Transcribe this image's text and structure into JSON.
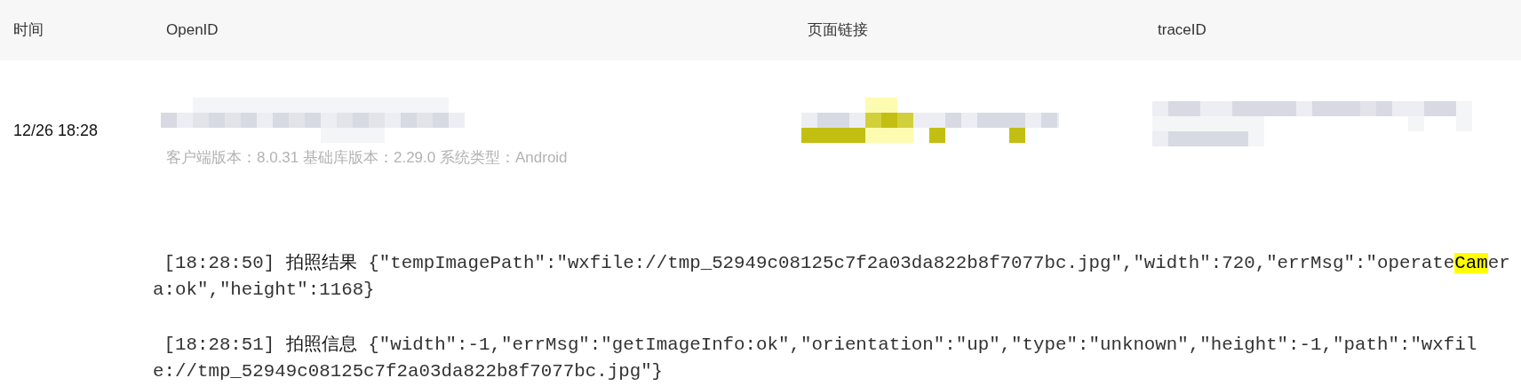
{
  "table": {
    "columns": [
      "时间",
      "OpenID",
      "页面链接",
      "traceID"
    ],
    "rows": [
      {
        "time": "12/26 18:28",
        "client_info": "客户端版本：8.0.31 基础库版本：2.29.0 系统类型：Android",
        "logs": [
          {
            "time": "[18:28:50]",
            "title": "拍照结果",
            "body": [
              {
                "kind": "text",
                "text": "{\"tempImagePath\":\"wxfile://tmp_52949c08125c7f2a03da822b8f7077bc.jpg\",\"width\":720,\"errMsg\":\"operate"
              },
              {
                "kind": "highlight",
                "text": "Cam"
              },
              {
                "kind": "text",
                "text": "era:ok\",\"height\":1168}"
              }
            ]
          },
          {
            "time": "[18:28:51]",
            "title": "拍照信息",
            "body": [
              {
                "text": "{\"width\":-1,\"errMsg\":\"getImageInfo:ok\",\"orientation\":\"up\",\"type\":\"unknown\",\"height\":-1,\"path\":\"wxfile://tmp_52949c08125c7f2a03da822b8f7077bc.jpg\"}",
                "kind": "text"
              }
            ]
          }
        ]
      }
    ]
  }
}
